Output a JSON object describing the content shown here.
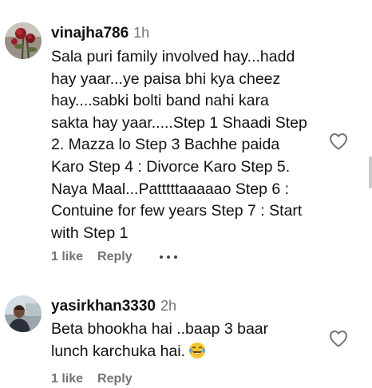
{
  "comments": [
    {
      "username": "vinajha786",
      "time": "1h",
      "text": "Sala puri family involved hay...hadd\nhay yaar...ye paisa bhi kya cheez\nhay....sabki bolti band nahi kara\nsakta hay yaar.....Step 1 Shaadi Step\n2. Mazza lo Step 3 Bachhe paida\nKaro Step 4 : Divorce Karo Step 5.\nNaya Maal...Patttttaaaaao Step 6 :\nContuine for few years Step 7 : Start\nwith Step 1",
      "likes": "1 like",
      "reply": "Reply"
    },
    {
      "username": "yasirkhan3330",
      "time": "2h",
      "text": "Beta bhookha hai ..baap 3 baar\nlunch karchuka hai.",
      "emoji": "laughing-crying-emoji",
      "likes": "1 like",
      "reply": "Reply"
    }
  ],
  "icons": {
    "heart": "heart-outline-icon",
    "more": "more-options-icon"
  }
}
